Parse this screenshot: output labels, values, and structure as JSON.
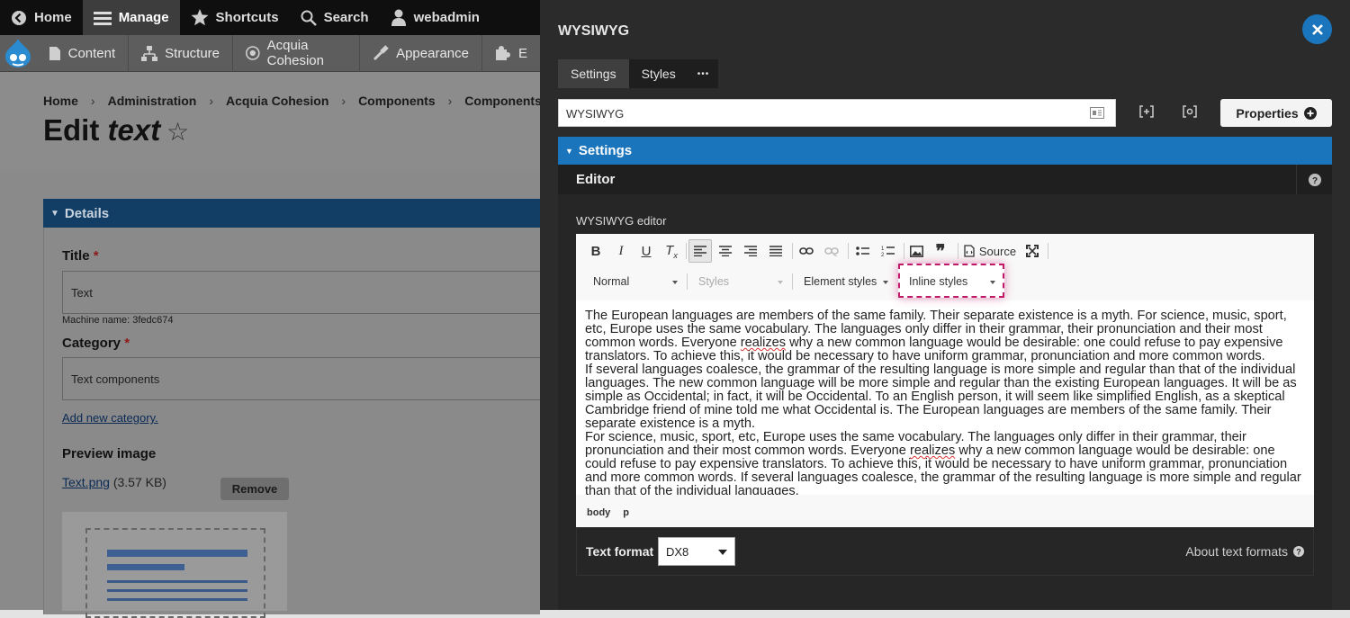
{
  "toolbar": {
    "home": "Home",
    "manage": "Manage",
    "shortcuts": "Shortcuts",
    "search": "Search",
    "user": "webadmin"
  },
  "tray": {
    "content": "Content",
    "structure": "Structure",
    "cohesion": "Acquia Cohesion",
    "appearance": "Appearance",
    "extend_partial": "E"
  },
  "breadcrumb": [
    "Home",
    "Administration",
    "Acquia Cohesion",
    "Components",
    "Components"
  ],
  "page": {
    "title_prefix": "Edit ",
    "title_em": "text",
    "details_label": "Details",
    "title_label": "Title",
    "title_value": "Text",
    "machine_name": "Machine name: 3fedc674",
    "category_label": "Category",
    "category_value": "Text components",
    "add_category": "Add new category.",
    "preview_label": "Preview image",
    "file_link": "Text.png",
    "file_size": "(3.57 KB)",
    "remove": "Remove"
  },
  "modal": {
    "title": "WYSIWYG",
    "tabs": [
      "Settings",
      "Styles"
    ],
    "more": "•••",
    "name_value": "WYSIWYG",
    "properties": "Properties",
    "settings_bar": "Settings",
    "editor_header": "Editor",
    "wysiwyg_label": "WYSIWYG editor",
    "source": "Source",
    "combos": {
      "format": "Normal",
      "styles": "Styles",
      "element_styles": "Element styles",
      "inline_styles": "Inline styles"
    },
    "content": {
      "p1_a": "The European languages are members of the same family. Their separate existence is a myth. For science, music, sport, etc, Europe uses the same vocabulary. The languages only differ in their grammar, their pronunciation and their most common words. Everyone ",
      "p1_sp": "realizes",
      "p1_b": " why a new common language would be desirable: one could refuse to pay expensive translators. To achieve this, it would be necessary to have uniform grammar, pronunciation and more common words.",
      "p2": "If several languages coalesce, the grammar of the resulting language is more simple and regular than that of the individual languages. The new common language will be more simple and regular than the existing European languages. It will be as simple as Occidental; in fact, it will be Occidental. To an English person, it will seem like simplified English, as a skeptical Cambridge friend of mine told me what Occidental is. The European languages are members of the same family. Their separate existence is a myth.",
      "p3_a": "For science, music, sport, etc, Europe uses the same vocabulary. The languages only differ in their grammar, their pronunciation and their most common words. Everyone ",
      "p3_sp": "realizes",
      "p3_b": " why a new common language would be desirable: one could refuse to pay expensive translators. To achieve this, it would be necessary to have uniform grammar, pronunciation and more common words. If several languages coalesce, the grammar of the resulting language is more simple and regular than that of the individual languages."
    },
    "path": [
      "body",
      "p"
    ],
    "text_format_label": "Text format",
    "text_format_value": "DX8",
    "about_formats": "About text formats"
  },
  "colors": {
    "accent": "#1b75bc",
    "highlight": "#c0196a"
  }
}
